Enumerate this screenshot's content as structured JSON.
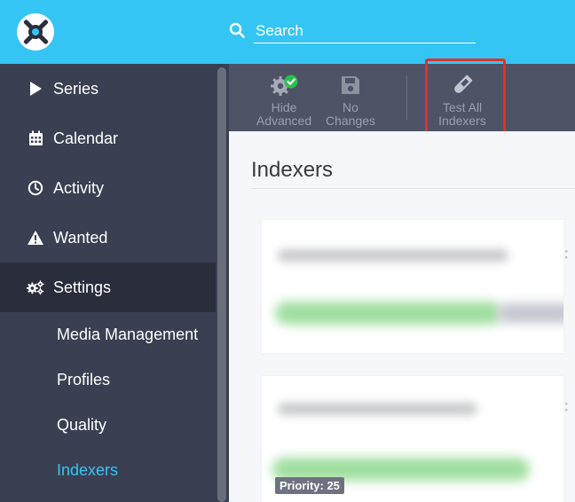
{
  "header": {
    "search_placeholder": "Search"
  },
  "sidebar": {
    "items": [
      {
        "label": "Series",
        "icon": "play-icon"
      },
      {
        "label": "Calendar",
        "icon": "calendar-icon"
      },
      {
        "label": "Activity",
        "icon": "clock-icon"
      },
      {
        "label": "Wanted",
        "icon": "warning-icon"
      },
      {
        "label": "Settings",
        "icon": "cogs-icon",
        "active": true
      }
    ],
    "subitems": [
      {
        "label": "Media Management"
      },
      {
        "label": "Profiles"
      },
      {
        "label": "Quality"
      },
      {
        "label": "Indexers",
        "current": true
      }
    ]
  },
  "toolbar": {
    "hide_advanced": {
      "line1": "Hide",
      "line2": "Advanced",
      "icon": "cog-check-icon"
    },
    "no_changes": {
      "line1": "No",
      "line2": "Changes",
      "icon": "save-icon"
    },
    "test_all": {
      "line1": "Test All",
      "line2": "Indexers",
      "icon": "flask-icon"
    }
  },
  "main": {
    "title": "Indexers",
    "priority_badge": "Priority: 25"
  },
  "colors": {
    "header": "#35c5f4",
    "sidebar": "#3a3f51",
    "sidebar_active": "#2a2e3c",
    "toolbar": "#4e5366",
    "accent": "#35c5f4",
    "highlight": "#e0302a"
  }
}
